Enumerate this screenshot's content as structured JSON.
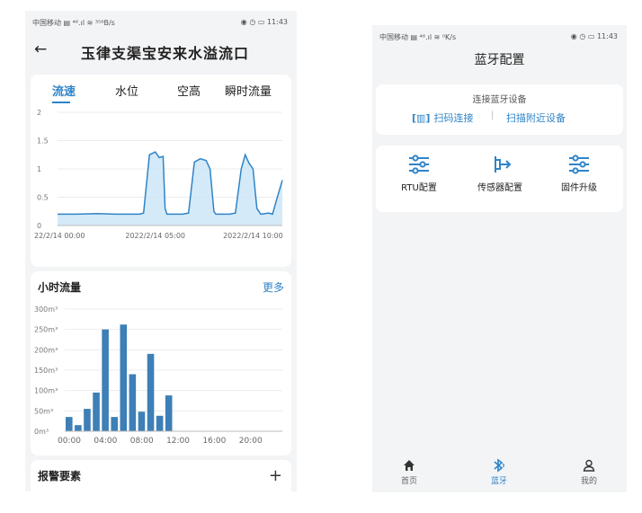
{
  "left": {
    "status_left": "中国移动 ▤ ⁴⁶.ıl ≋ ³⁵⁶B/s",
    "status_right": "◉ ◷ ▭ 11:43",
    "title": "玉律支渠宝安来水溢流口",
    "tabs": [
      "流速",
      "水位",
      "空高",
      "瞬时流量"
    ],
    "active_tab": 0,
    "hourly_title": "小时流量",
    "more_label": "更多",
    "alarm_title": "报警要素",
    "add_label": "+"
  },
  "right": {
    "status_left": "中国移动 ▤ ⁴⁶.ıl ≋ ⁰K/s",
    "status_right": "◉ ◷ ▭ 11:43",
    "title": "蓝牙配置",
    "connect_heading": "连接蓝牙设备",
    "scan_label": "扫码连接",
    "separator": "|",
    "nearby_label": "扫描附近设备",
    "functions": [
      {
        "label": "RTU配置",
        "icon": "sliders-icon"
      },
      {
        "label": "传感器配置",
        "icon": "sensor-arrow-icon"
      },
      {
        "label": "固件升级",
        "icon": "sliders-icon"
      }
    ],
    "nav": [
      {
        "label": "首页",
        "icon": "home-icon",
        "active": false
      },
      {
        "label": "蓝牙",
        "icon": "bluetooth-icon",
        "active": true
      },
      {
        "label": "我的",
        "icon": "user-icon",
        "active": false
      }
    ]
  },
  "colors": {
    "accent": "#2f84c8",
    "bar": "#3d7fb6",
    "area": "#cde6f7"
  },
  "chart_data": [
    {
      "type": "area",
      "title": "",
      "ylim": [
        0,
        2
      ],
      "yticks": [
        "2",
        "1.5",
        "1",
        "0.5",
        "0"
      ],
      "xticks": [
        "22/2/14 00:00",
        "2022/2/14 05:00",
        "2022/2/14 10:00"
      ],
      "x_range_hours": [
        0,
        11.5
      ],
      "series": [
        {
          "x": [
            0,
            1,
            2,
            3,
            4.2,
            4.4,
            4.7,
            5.0,
            5.2,
            5.4,
            5.5,
            5.6,
            6.4,
            6.7,
            7.0,
            7.3,
            7.6,
            7.8,
            8.0,
            8.1,
            8.8,
            9.1,
            9.4,
            9.6,
            9.8,
            10.0,
            10.2,
            10.4,
            10.8,
            11.0,
            11.2,
            11.5
          ],
          "values": [
            0.2,
            0.2,
            0.21,
            0.2,
            0.2,
            0.22,
            1.25,
            1.3,
            1.2,
            1.22,
            0.3,
            0.2,
            0.2,
            0.22,
            1.12,
            1.18,
            1.15,
            1.0,
            0.25,
            0.2,
            0.2,
            0.22,
            1.0,
            1.25,
            1.1,
            1.0,
            0.3,
            0.2,
            0.22,
            0.2,
            0.45,
            0.8
          ]
        }
      ]
    },
    {
      "type": "bar",
      "title": "",
      "ylim": [
        0,
        300
      ],
      "yticks": [
        "300m³",
        "250m³",
        "200m³",
        "150m³",
        "100m³",
        "50m³",
        "0m³"
      ],
      "xticks": [
        "00:00",
        "04:00",
        "08:00",
        "12:00",
        "16:00",
        "20:00"
      ],
      "categories": [
        "00",
        "01",
        "02",
        "03",
        "04",
        "05",
        "06",
        "07",
        "08",
        "09",
        "10",
        "11"
      ],
      "values": [
        35,
        15,
        55,
        95,
        250,
        35,
        262,
        140,
        48,
        190,
        38,
        88
      ]
    }
  ]
}
